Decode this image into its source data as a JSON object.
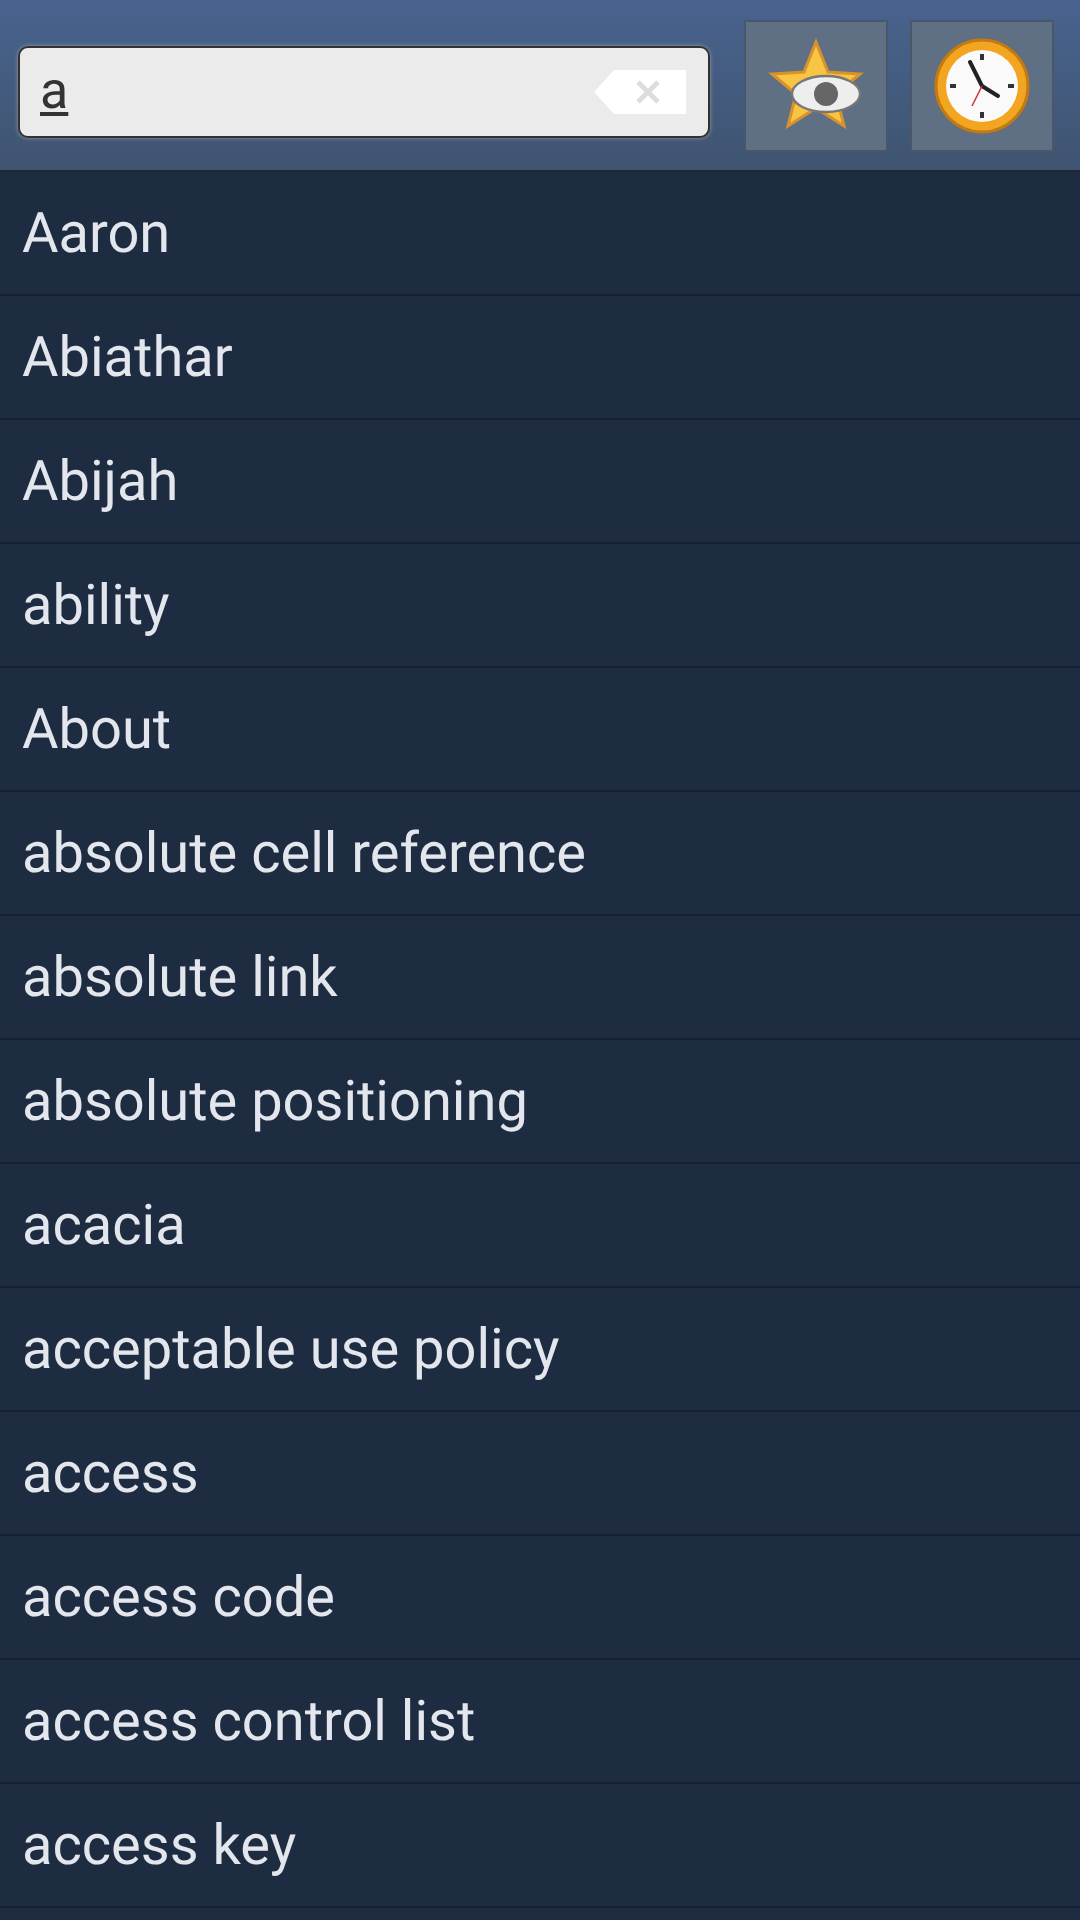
{
  "search": {
    "value": "a"
  },
  "words": [
    "Aaron",
    "Abiathar",
    "Abijah",
    "ability",
    "About",
    "absolute cell reference",
    "absolute link",
    "absolute positioning",
    "acacia",
    "acceptable use policy",
    "access",
    "access code",
    "access control list",
    "access key"
  ]
}
